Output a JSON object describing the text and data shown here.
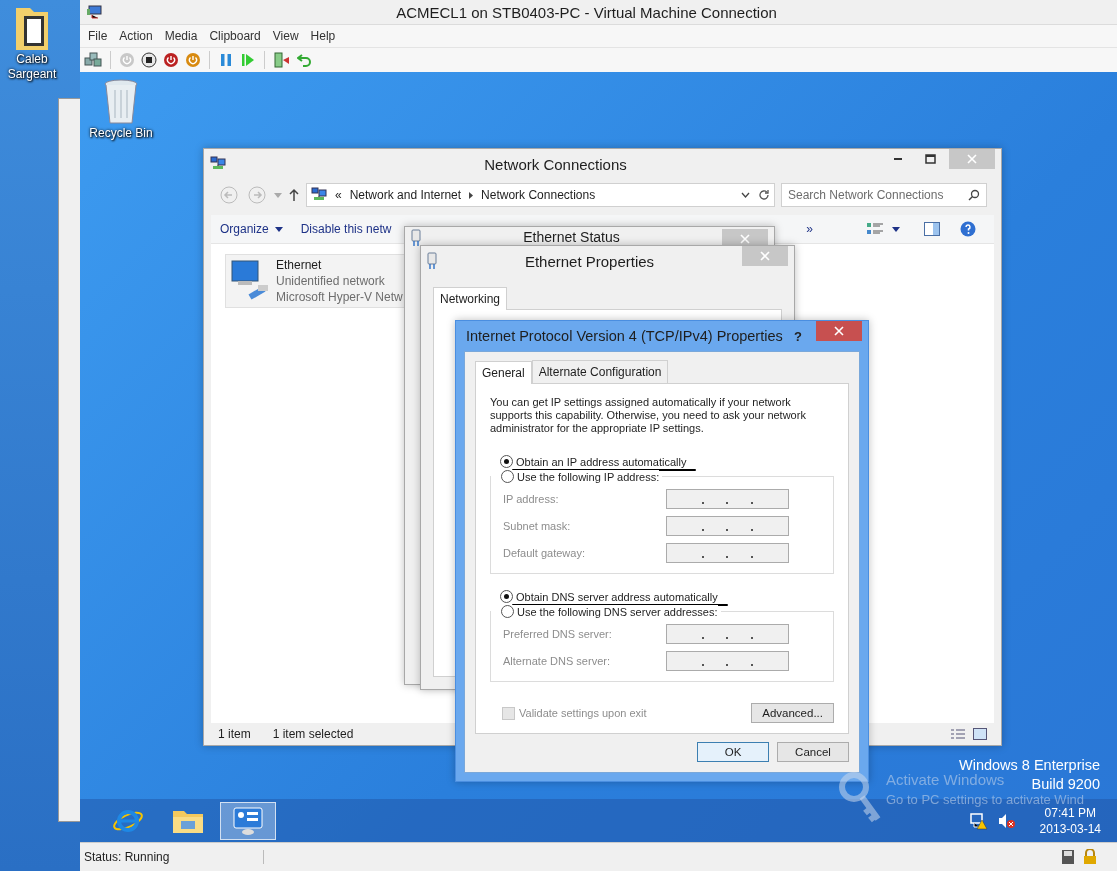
{
  "host_desktop": {
    "icons": [
      {
        "label": "Caleb Sargeant"
      }
    ]
  },
  "vm_window": {
    "title": "ACMECL1 on STB0403-PC - Virtual Machine Connection",
    "menu": [
      "File",
      "Action",
      "Media",
      "Clipboard",
      "View",
      "Help"
    ],
    "status": "Status: Running"
  },
  "guest_desktop": {
    "icons": [
      {
        "label": "Recycle Bin"
      }
    ],
    "edition": "Windows 8 Enterprise",
    "build": "Build 9200",
    "activation": {
      "title": "Activate Windows",
      "message": "Go to PC settings to activate Wind"
    },
    "taskbar": [
      {
        "kind": "browser",
        "selected": false
      },
      {
        "kind": "folder",
        "selected": false
      },
      {
        "kind": "control-panel",
        "selected": true
      }
    ],
    "clock": {
      "time": "07:41 PM",
      "date": "2013-03-14"
    }
  },
  "network_connections": {
    "title": "Network Connections",
    "breadcrumb": [
      "«",
      "Network and Internet",
      "Network Connections"
    ],
    "search": {
      "placeholder": "Search Network Connections"
    },
    "commands": [
      "Organize",
      "Disable this netw"
    ],
    "more": "»",
    "items": [
      {
        "name": "Ethernet",
        "status": "Unidentified network",
        "device": "Microsoft Hyper-V Netw"
      }
    ],
    "status_bar": [
      "1 item",
      "1 item selected"
    ]
  },
  "ethernet_status": {
    "title": "Ethernet Status"
  },
  "ethernet_properties": {
    "title": "Ethernet Properties",
    "tabs": [
      {
        "label": "Networking",
        "selected": true
      }
    ]
  },
  "ipv4_dialog": {
    "title": "Internet Protocol Version 4 (TCP/IPv4) Properties",
    "help": "?",
    "tabs": [
      {
        "label": "General",
        "selected": true
      },
      {
        "label": "Alternate Configuration",
        "selected": false
      }
    ],
    "description": "You can get IP settings assigned automatically if your network supports this capability. Otherwise, you need to ask your network administrator for the appropriate IP settings.",
    "ip_options": [
      {
        "label": "Obtain an IP address automatically",
        "selected": true,
        "annotated": true
      },
      {
        "label": "Use the following IP address:",
        "selected": false,
        "annotated": false
      }
    ],
    "ip_fields": [
      {
        "label": "IP address:",
        "disabled": true
      },
      {
        "label": "Subnet mask:",
        "disabled": true
      },
      {
        "label": "Default gateway:",
        "disabled": true
      }
    ],
    "dns_options": [
      {
        "label": "Obtain DNS server address automatically",
        "selected": true,
        "annotated": true
      },
      {
        "label": "Use the following DNS server addresses:",
        "selected": false,
        "annotated": false
      }
    ],
    "dns_fields": [
      {
        "label": "Preferred DNS server:",
        "disabled": true
      },
      {
        "label": "Alternate DNS server:",
        "disabled": true
      }
    ],
    "validate": {
      "label": "Validate settings upon exit",
      "checked": false,
      "disabled": true
    },
    "advanced": "Advanced...",
    "ok": "OK",
    "cancel": "Cancel"
  }
}
